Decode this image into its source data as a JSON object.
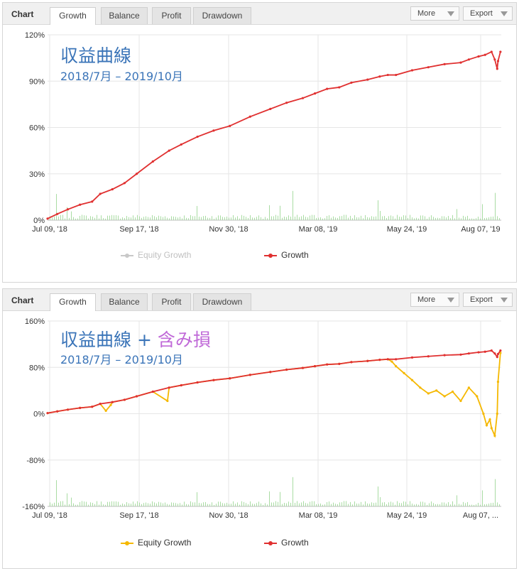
{
  "tabs": {
    "title": "Chart",
    "items": [
      "Growth",
      "Balance",
      "Profit",
      "Drawdown"
    ],
    "active": "Growth"
  },
  "buttons": {
    "more": "More",
    "export": "Export"
  },
  "colors": {
    "growth": "#e03030",
    "equity": "#f5b800",
    "equity_hidden": "#c8c8c8",
    "bars": "#a9dca3",
    "grid": "#e6e6e6",
    "title_blue": "#3a74b8",
    "title_purple": "#c06ad8"
  },
  "panel1": {
    "annotation": {
      "title": "収益曲線",
      "subtitle": "2018/7月 – 2019/10月"
    },
    "legend": {
      "equity": "Equity Growth",
      "growth": "Growth",
      "equity_visible": false
    },
    "chart_data": {
      "type": "line",
      "y_ticks": [
        "120%",
        "90%",
        "60%",
        "30%",
        "0%"
      ],
      "x_ticks": [
        "Jul 09, '18",
        "Sep 17, '18",
        "Nov 30, '18",
        "Mar 08, '19",
        "May 24, '19",
        "Aug 07, '19"
      ],
      "ylim": [
        0,
        120
      ],
      "series": [
        {
          "name": "Growth",
          "x": [
            0,
            12,
            25,
            40,
            55,
            65,
            80,
            95,
            110,
            130,
            150,
            165,
            185,
            205,
            225,
            250,
            275,
            295,
            315,
            330,
            345,
            360,
            375,
            395,
            410,
            420,
            430,
            450,
            470,
            490,
            510,
            520,
            532,
            540,
            548,
            552,
            555,
            556,
            559
          ],
          "y": [
            1,
            4,
            7,
            10,
            12,
            17,
            20,
            24,
            30,
            38,
            45,
            49,
            54,
            58,
            61,
            67,
            72,
            76,
            79,
            82,
            85,
            86,
            89,
            91,
            93,
            94,
            94,
            97,
            99,
            101,
            102,
            104,
            106,
            107,
            109,
            104,
            98,
            103,
            109
          ]
        }
      ],
      "equity": null
    }
  },
  "panel2": {
    "annotation": {
      "title": "収益曲線",
      "plus": " + ",
      "extra": "含み損",
      "subtitle": "2018/7月 – 2019/10月"
    },
    "legend": {
      "equity": "Equity Growth",
      "growth": "Growth",
      "equity_visible": true
    },
    "chart_data": {
      "type": "line",
      "y_ticks": [
        "160%",
        "80%",
        "0%",
        "-80%",
        "-160%"
      ],
      "x_ticks": [
        "Jul 09, '18",
        "Sep 17, '18",
        "Nov 30, '18",
        "Mar 08, '19",
        "May 24, '19",
        "Aug 07, ..."
      ],
      "ylim": [
        -160,
        160
      ],
      "series": [
        {
          "name": "Growth",
          "x": [
            0,
            12,
            25,
            40,
            55,
            65,
            80,
            95,
            110,
            130,
            150,
            165,
            185,
            205,
            225,
            250,
            275,
            295,
            315,
            330,
            345,
            360,
            375,
            395,
            410,
            420,
            430,
            450,
            470,
            490,
            510,
            520,
            532,
            540,
            548,
            552,
            555,
            556,
            559
          ],
          "y": [
            1,
            4,
            7,
            10,
            12,
            17,
            20,
            24,
            30,
            38,
            45,
            49,
            54,
            58,
            61,
            67,
            72,
            76,
            79,
            82,
            85,
            86,
            89,
            91,
            93,
            94,
            94,
            97,
            99,
            101,
            102,
            104,
            106,
            107,
            109,
            104,
            98,
            103,
            109
          ]
        },
        {
          "name": "Equity Growth",
          "x": [
            0,
            12,
            25,
            40,
            55,
            65,
            72,
            78,
            80,
            95,
            110,
            130,
            148,
            150,
            165,
            185,
            205,
            225,
            250,
            275,
            295,
            315,
            330,
            345,
            360,
            375,
            395,
            410,
            420,
            425,
            430,
            440,
            450,
            460,
            470,
            480,
            490,
            500,
            510,
            520,
            530,
            538,
            542,
            546,
            548,
            552,
            555,
            556,
            559
          ],
          "y": [
            1,
            4,
            7,
            10,
            12,
            17,
            5,
            15,
            20,
            24,
            30,
            38,
            22,
            45,
            49,
            54,
            58,
            61,
            67,
            72,
            76,
            79,
            82,
            85,
            86,
            89,
            91,
            93,
            94,
            90,
            82,
            70,
            58,
            45,
            35,
            40,
            30,
            38,
            22,
            45,
            30,
            0,
            -20,
            -10,
            -25,
            -38,
            0,
            55,
            105
          ]
        }
      ]
    }
  }
}
